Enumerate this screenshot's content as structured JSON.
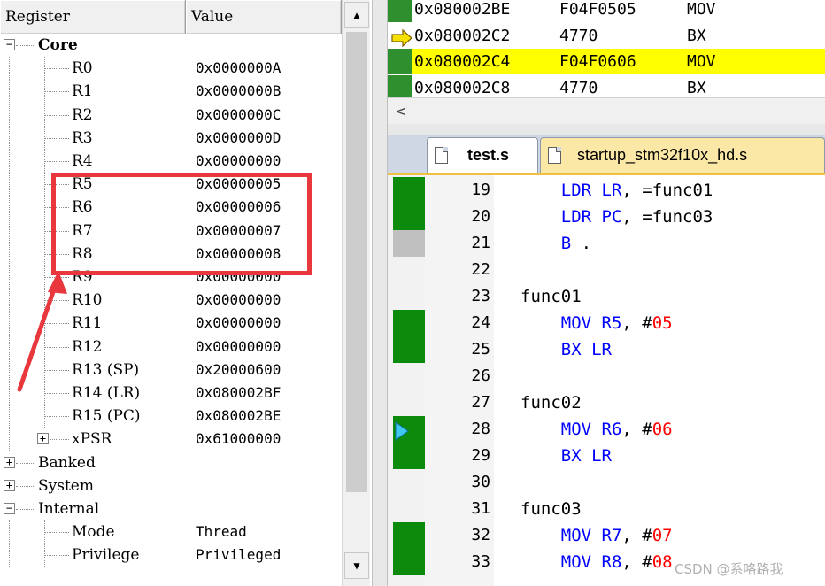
{
  "register_panel": {
    "header": {
      "register": "Register",
      "value": "Value"
    },
    "rows": [
      {
        "label": "Core",
        "value": "",
        "level": 0,
        "expander": "minus",
        "bold": true
      },
      {
        "label": "R0",
        "value": "0x0000000A",
        "level": 1
      },
      {
        "label": "R1",
        "value": "0x0000000B",
        "level": 1
      },
      {
        "label": "R2",
        "value": "0x0000000C",
        "level": 1
      },
      {
        "label": "R3",
        "value": "0x0000000D",
        "level": 1
      },
      {
        "label": "R4",
        "value": "0x00000000",
        "level": 1
      },
      {
        "label": "R5",
        "value": "0x00000005",
        "level": 1
      },
      {
        "label": "R6",
        "value": "0x00000006",
        "level": 1
      },
      {
        "label": "R7",
        "value": "0x00000007",
        "level": 1
      },
      {
        "label": "R8",
        "value": "0x00000008",
        "level": 1
      },
      {
        "label": "R9",
        "value": "0x00000000",
        "level": 1
      },
      {
        "label": "R10",
        "value": "0x00000000",
        "level": 1
      },
      {
        "label": "R11",
        "value": "0x00000000",
        "level": 1
      },
      {
        "label": "R12",
        "value": "0x00000000",
        "level": 1
      },
      {
        "label": "R13 (SP)",
        "value": "0x20000600",
        "level": 1
      },
      {
        "label": "R14 (LR)",
        "value": "0x080002BF",
        "level": 1
      },
      {
        "label": "R15 (PC)",
        "value": "0x080002BE",
        "level": 1
      },
      {
        "label": "xPSR",
        "value": "0x61000000",
        "level": 1,
        "expander": "plus"
      },
      {
        "label": "Banked",
        "value": "",
        "level": 0,
        "expander": "plus"
      },
      {
        "label": "System",
        "value": "",
        "level": 0,
        "expander": "plus"
      },
      {
        "label": "Internal",
        "value": "",
        "level": 0,
        "expander": "minus"
      },
      {
        "label": "Mode",
        "value": "Thread",
        "level": 1
      },
      {
        "label": "Privilege",
        "value": "Privileged",
        "level": 1
      }
    ],
    "scroll": {
      "up_glyph": "▲",
      "down_glyph": "▼"
    }
  },
  "disassembly": {
    "rows": [
      {
        "address": "0x080002BE",
        "opcode": "F04F0505",
        "mnemonic": "MOV",
        "highlight": false,
        "current": false
      },
      {
        "address": "0x080002C2",
        "opcode": "4770",
        "mnemonic": "BX",
        "highlight": false,
        "current": true
      },
      {
        "address": "0x080002C4",
        "opcode": "F04F0606",
        "mnemonic": "MOV",
        "highlight": true,
        "current": false
      },
      {
        "address": "0x080002C8",
        "opcode": "4770",
        "mnemonic": "BX",
        "highlight": false,
        "current": false
      }
    ],
    "scroll_left_glyph": "<"
  },
  "tabs": [
    {
      "label": "test.s",
      "active": true
    },
    {
      "label": "startup_stm32f10x_hd.s",
      "active": false
    }
  ],
  "editor": {
    "lines": [
      {
        "num": "19",
        "coverage": "green",
        "tokens": [
          [
            "kw",
            "    LDR "
          ],
          [
            "kw",
            "LR"
          ],
          [
            "txt",
            ", =func01"
          ]
        ]
      },
      {
        "num": "20",
        "coverage": "green",
        "tokens": [
          [
            "kw",
            "    LDR "
          ],
          [
            "kw",
            "PC"
          ],
          [
            "txt",
            ", =func03"
          ]
        ]
      },
      {
        "num": "21",
        "coverage": "grey",
        "tokens": [
          [
            "kw",
            "    B "
          ],
          [
            "txt",
            "."
          ]
        ]
      },
      {
        "num": "22",
        "coverage": "none",
        "tokens": []
      },
      {
        "num": "23",
        "coverage": "none",
        "tokens": [
          [
            "lbl",
            "func01"
          ]
        ]
      },
      {
        "num": "24",
        "coverage": "green",
        "tokens": [
          [
            "kw",
            "    MOV "
          ],
          [
            "kw",
            "R5"
          ],
          [
            "txt",
            ", #"
          ],
          [
            "num",
            "05"
          ]
        ]
      },
      {
        "num": "25",
        "coverage": "green",
        "tokens": [
          [
            "kw",
            "    BX "
          ],
          [
            "kw",
            "LR"
          ]
        ]
      },
      {
        "num": "26",
        "coverage": "none",
        "tokens": []
      },
      {
        "num": "27",
        "coverage": "none",
        "tokens": [
          [
            "lbl",
            "func02"
          ]
        ]
      },
      {
        "num": "28",
        "coverage": "green",
        "tokens": [
          [
            "kw",
            "    MOV "
          ],
          [
            "kw",
            "R6"
          ],
          [
            "txt",
            ", #"
          ],
          [
            "num",
            "06"
          ]
        ]
      },
      {
        "num": "29",
        "coverage": "green",
        "tokens": [
          [
            "kw",
            "    BX "
          ],
          [
            "kw",
            "LR"
          ]
        ]
      },
      {
        "num": "30",
        "coverage": "none",
        "tokens": []
      },
      {
        "num": "31",
        "coverage": "none",
        "tokens": [
          [
            "lbl",
            "func03"
          ]
        ]
      },
      {
        "num": "32",
        "coverage": "green",
        "tokens": [
          [
            "kw",
            "    MOV "
          ],
          [
            "kw",
            "R7"
          ],
          [
            "txt",
            ", #"
          ],
          [
            "num",
            "07"
          ]
        ]
      },
      {
        "num": "33",
        "coverage": "green",
        "tokens": [
          [
            "kw",
            "    MOV "
          ],
          [
            "kw",
            "R8"
          ],
          [
            "txt",
            ", #"
          ],
          [
            "num",
            "08"
          ]
        ]
      }
    ]
  },
  "colors": {
    "highlight_yellow": "#ffff00",
    "coverage_green": "#0b8a0b",
    "annotation_red": "#e8383d",
    "keyword_blue": "#0000ff",
    "number_red": "#ff0000"
  },
  "watermark": "CSDN @系咯路我"
}
